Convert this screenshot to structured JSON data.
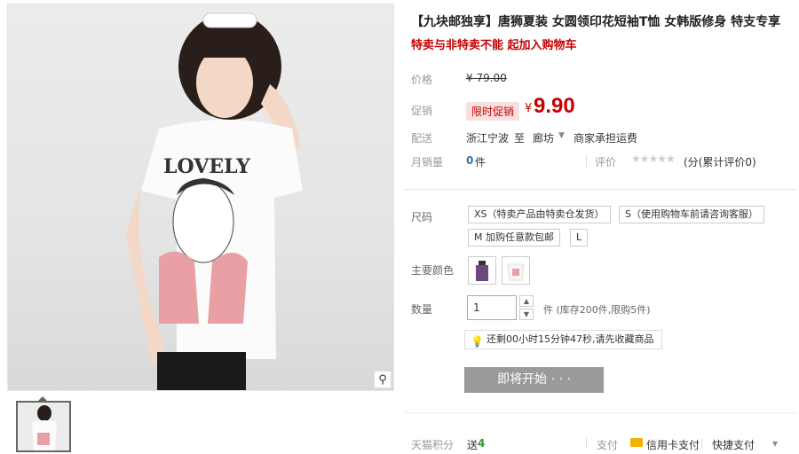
{
  "product": {
    "title": "【九块邮独享】唐狮夏装 女圆领印花短袖T恤 女韩版修身 特支专享",
    "subtitle": "特卖与非特卖不能   起加入购物车",
    "image_text": "LOVELY"
  },
  "price": {
    "label": "价格",
    "original": "¥ 79.00",
    "promo_label": "促销",
    "promo_tag": "限时促销",
    "yen": "¥",
    "current": "9.90"
  },
  "shipping": {
    "label": "配送",
    "from": "浙江宁波",
    "to_word": "至",
    "dest": "廊坊",
    "fee": "商家承担运费"
  },
  "sales": {
    "label": "月销量",
    "count": "0",
    "unit": "件",
    "rating_label": "评价",
    "stars": "★★★★★",
    "rating_text": "(分(累计评价0)"
  },
  "size": {
    "label": "尺码",
    "options": [
      "XS（特卖产品由特卖仓发货）",
      "S（使用购物车前请咨询客服）",
      "M 加购任意款包邮",
      "L"
    ]
  },
  "color": {
    "label": "主要颜色"
  },
  "quantity": {
    "label": "数量",
    "value": "1",
    "unit_text": "件 (库存200件,限购5件)",
    "up": "▲",
    "down": "▼"
  },
  "timer": {
    "text": "还剩00小时15分钟47秒,请先收藏商品"
  },
  "action": {
    "button": "即将开始 · · ·"
  },
  "footer": {
    "points_label": "天猫积分",
    "points_send": "送",
    "points_value": "4",
    "pay_label": "支付",
    "credit": "信用卡支付",
    "quick": "快捷支付",
    "more": "▾"
  },
  "colors": {
    "accent": "#c40000",
    "link": "#3a6eae"
  }
}
